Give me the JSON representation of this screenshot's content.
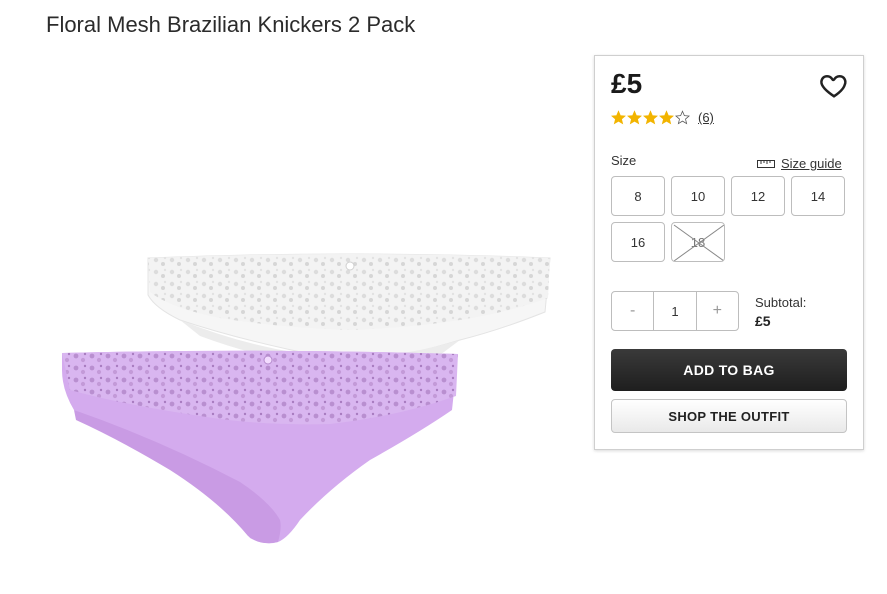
{
  "product": {
    "title": "Floral Mesh Brazilian Knickers 2 Pack",
    "image_alt": "Floral mesh knickers in white and lilac"
  },
  "panel": {
    "price": "£5",
    "rating": {
      "value": 4,
      "max": 5,
      "review_count": "(6)"
    },
    "size_label": "Size",
    "size_guide_label": "Size guide",
    "sizes": [
      {
        "label": "8",
        "available": true
      },
      {
        "label": "10",
        "available": true
      },
      {
        "label": "12",
        "available": true
      },
      {
        "label": "14",
        "available": true
      },
      {
        "label": "16",
        "available": true
      },
      {
        "label": "18",
        "available": false
      }
    ],
    "quantity": {
      "minus": "-",
      "value": "1",
      "plus": "+"
    },
    "subtotal_label": "Subtotal:",
    "subtotal_value": "£5",
    "add_to_bag_label": "ADD TO BAG",
    "shop_outfit_label": "SHOP THE OUTFIT"
  },
  "colors": {
    "star": "#f2b400",
    "primary_button": "#262626",
    "lilac": "#d2a8ee"
  },
  "icons": [
    "heart-icon",
    "star-icon",
    "ruler-icon"
  ]
}
